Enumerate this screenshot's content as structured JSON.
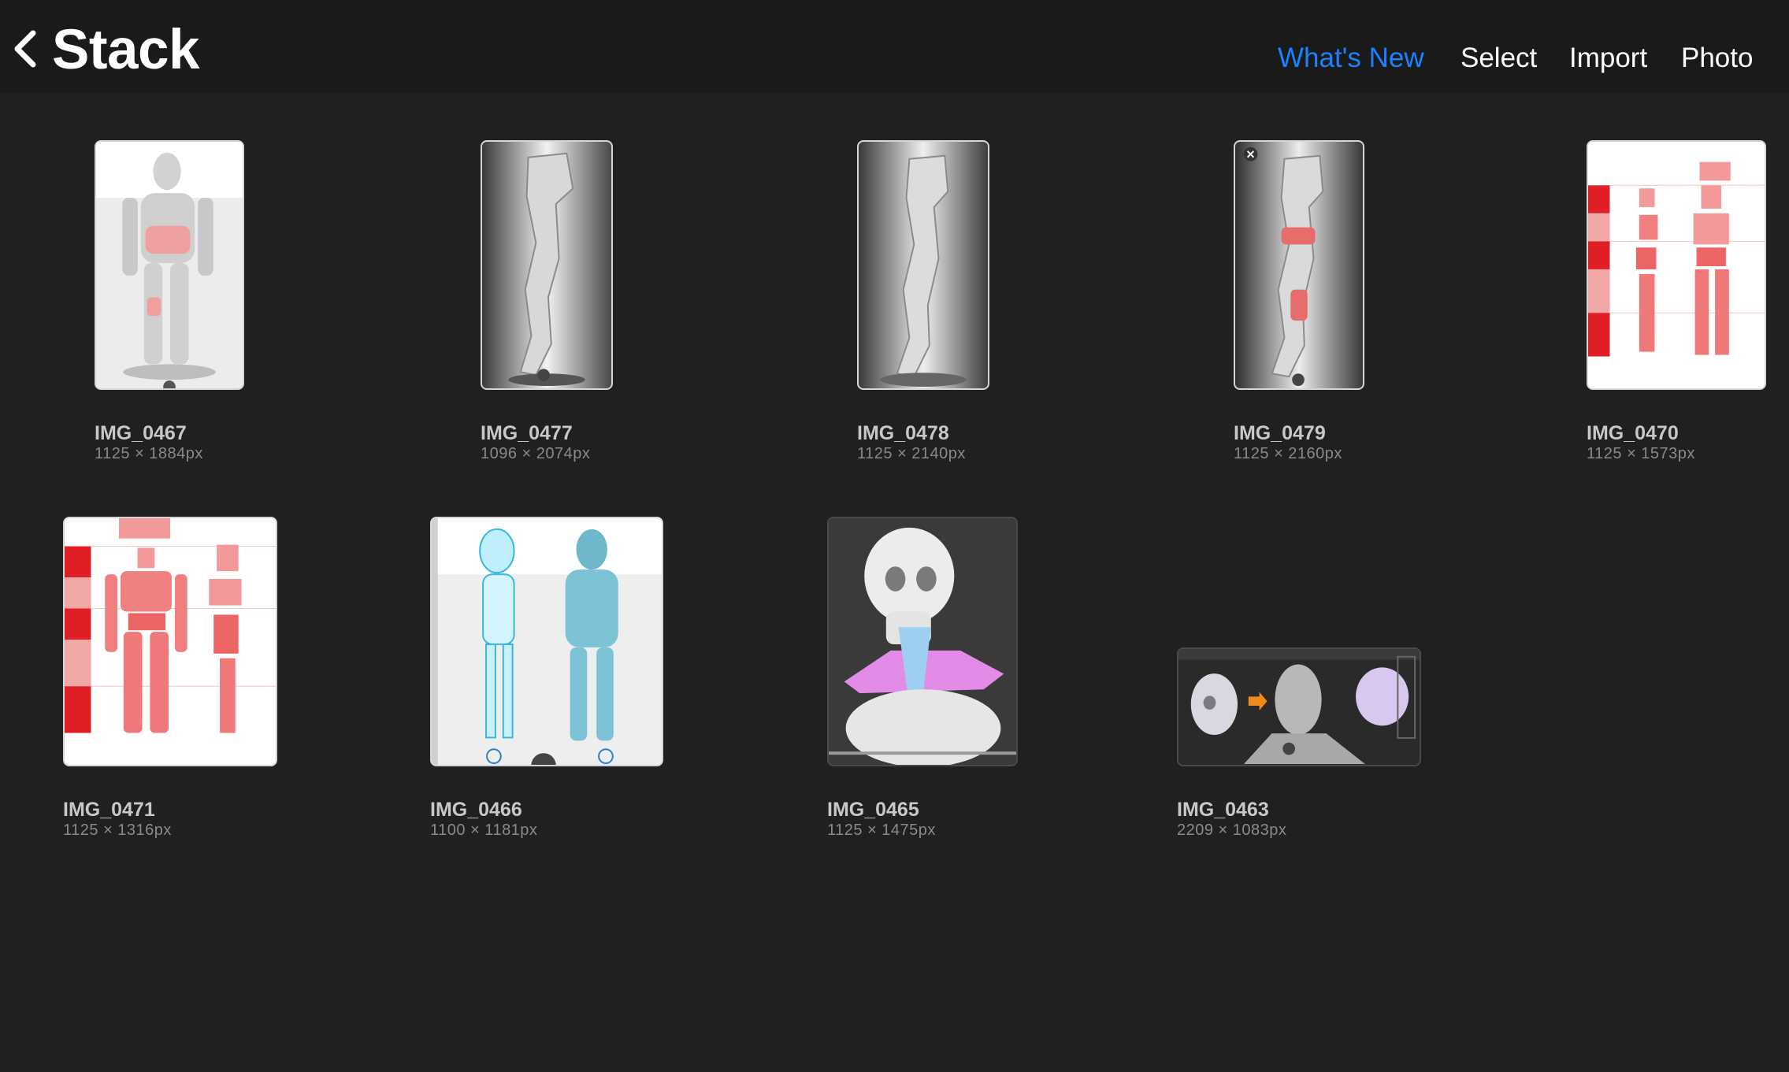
{
  "header": {
    "title": "Stack",
    "back_icon": "chevron-left-icon",
    "accent_color": "#1a82ff",
    "nav": {
      "whats_new": "What's New",
      "select": "Select",
      "import": "Import",
      "photo": "Photo"
    }
  },
  "gallery": {
    "items": [
      {
        "name": "IMG_0467",
        "dims": "1125 × 1884px"
      },
      {
        "name": "IMG_0477",
        "dims": "1096 × 2074px"
      },
      {
        "name": "IMG_0478",
        "dims": "1125 × 2140px"
      },
      {
        "name": "IMG_0479",
        "dims": "1125 × 2160px"
      },
      {
        "name": "IMG_0470",
        "dims": "1125 × 1573px"
      },
      {
        "name": "IMG_0471",
        "dims": "1125 × 1316px"
      },
      {
        "name": "IMG_0466",
        "dims": "1100 × 1181px"
      },
      {
        "name": "IMG_0465",
        "dims": "1125 × 1475px"
      },
      {
        "name": "IMG_0463",
        "dims": "2209 × 1083px"
      }
    ]
  }
}
